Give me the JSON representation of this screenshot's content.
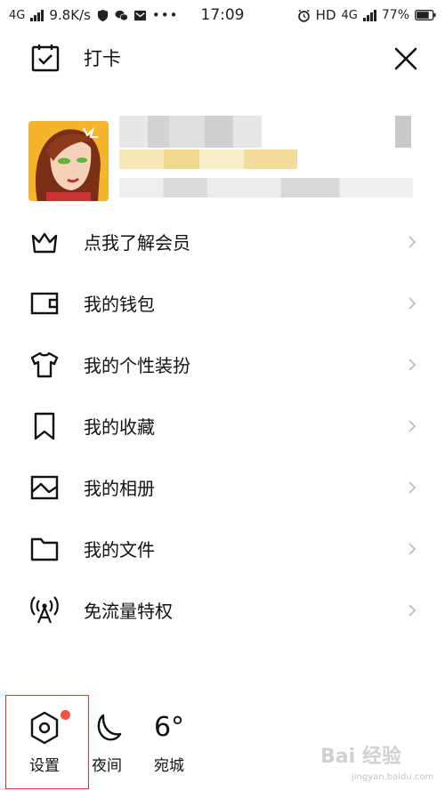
{
  "status_bar": {
    "network_left": "4G",
    "speed": "9.8K/s",
    "time": "17:09",
    "hd": "HD",
    "network_right": "4G",
    "battery": "77%"
  },
  "header": {
    "checkin_label": "打卡"
  },
  "menu": {
    "items": [
      {
        "label": "点我了解会员",
        "icon": "crown-icon"
      },
      {
        "label": "我的钱包",
        "icon": "wallet-icon"
      },
      {
        "label": "我的个性装扮",
        "icon": "tshirt-icon"
      },
      {
        "label": "我的收藏",
        "icon": "bookmark-icon"
      },
      {
        "label": "我的相册",
        "icon": "photo-icon"
      },
      {
        "label": "我的文件",
        "icon": "folder-icon"
      },
      {
        "label": "免流量特权",
        "icon": "signal-tower-icon"
      }
    ]
  },
  "bottom": {
    "settings_label": "设置",
    "night_label": "夜间",
    "weather_temp": "6°",
    "weather_city": "宛城"
  },
  "watermark": {
    "text": "Bai 经验",
    "sub": "jingyan.baidu.com"
  },
  "colors": {
    "notice_dot": "#f2553e",
    "highlight_border": "#dd3333"
  }
}
